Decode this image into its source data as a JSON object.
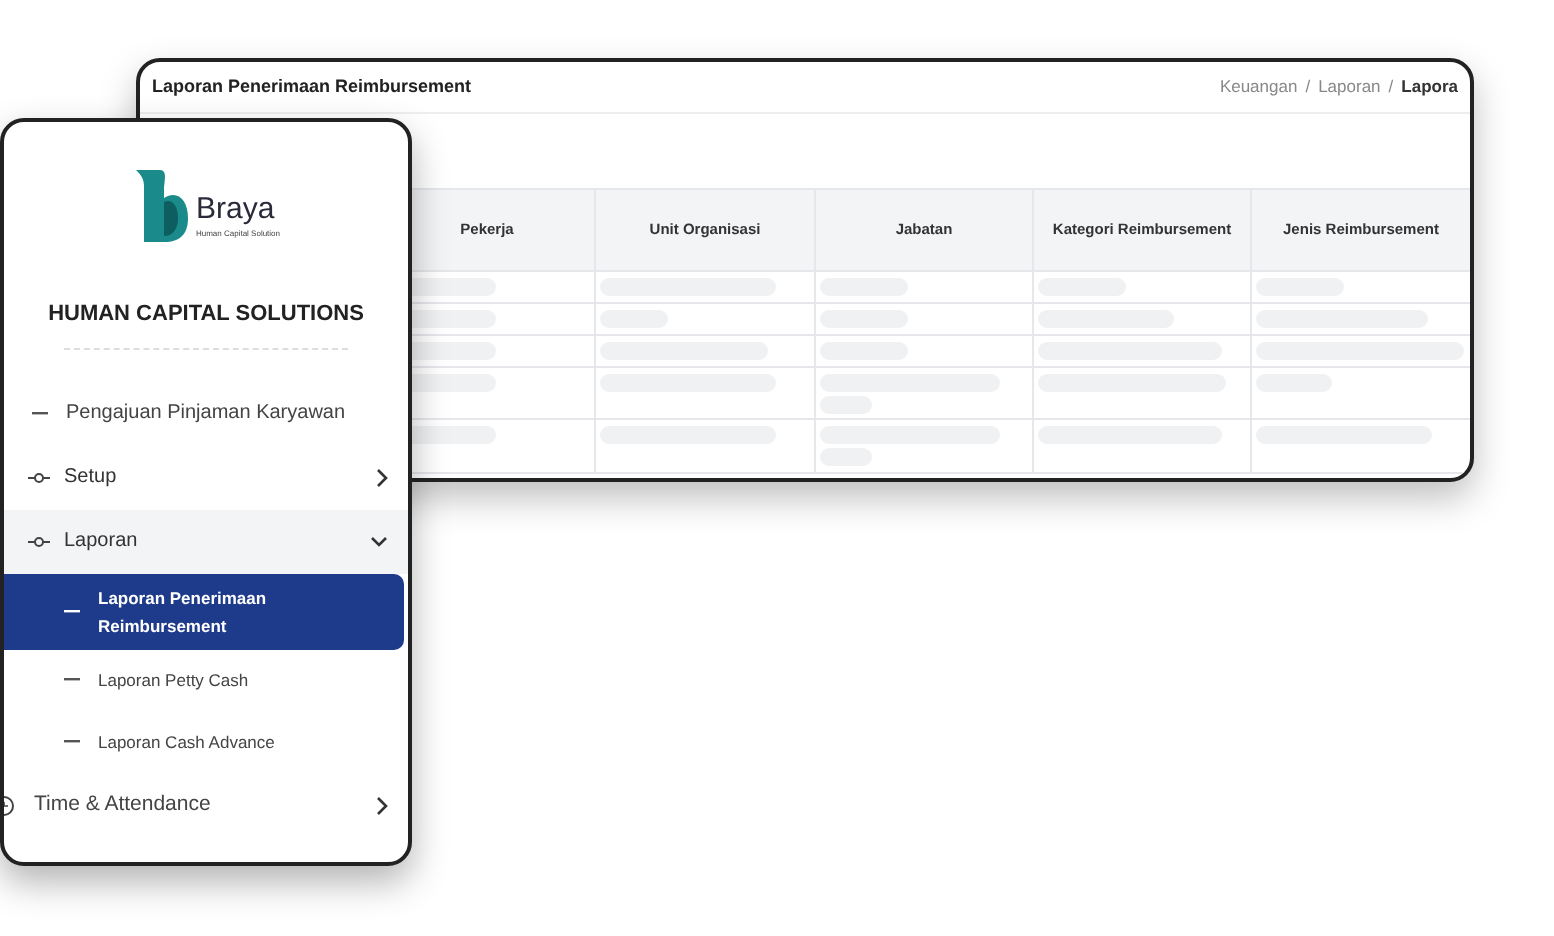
{
  "report_window": {
    "title": "Laporan Penerimaan Reimbursement",
    "breadcrumb_separator": "/",
    "breadcrumb": [
      {
        "label": "Keuangan",
        "current": false
      },
      {
        "label": "Laporan",
        "current": false
      },
      {
        "label": "Lapora",
        "current": true
      }
    ],
    "table": {
      "columns": [
        "Pekerja",
        "Unit Organisasi",
        "Jabatan",
        "Kategori Reimbursement",
        "Jenis Reimbursement"
      ]
    }
  },
  "sidebar": {
    "logo": {
      "name": "Braya",
      "tagline": "Human Capital Solution"
    },
    "title": "HUMAN CAPITAL SOLUTIONS",
    "items": [
      {
        "label": "Pengajuan Pinjaman Karyawan",
        "kind": "leaf"
      },
      {
        "label": "Setup",
        "kind": "group",
        "expanded": false
      },
      {
        "label": "Laporan",
        "kind": "group",
        "expanded": true,
        "children": [
          {
            "label": "Laporan Penerimaan Reimbursement",
            "selected": true
          },
          {
            "label": "Laporan Petty Cash",
            "selected": false
          },
          {
            "label": "Laporan Cash Advance",
            "selected": false
          }
        ]
      },
      {
        "label": "Time & Attendance",
        "kind": "module",
        "expanded": false
      }
    ]
  }
}
